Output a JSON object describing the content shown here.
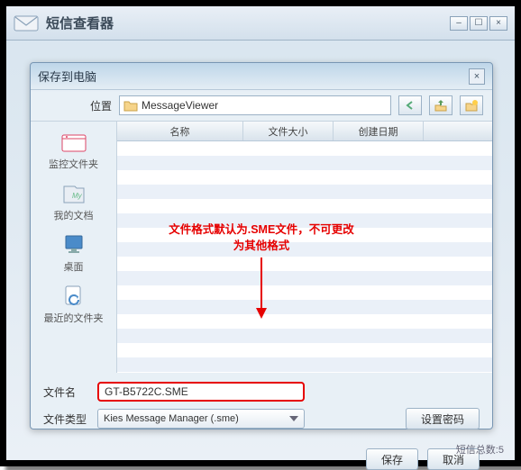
{
  "app": {
    "title": "短信查看器"
  },
  "dialog": {
    "title": "保存到电脑",
    "location_label": "位置",
    "path_text": "MessageViewer",
    "columns": {
      "name": "名称",
      "size": "文件大小",
      "date": "创建日期"
    },
    "sidebar": {
      "items": [
        {
          "label": "监控文件夹"
        },
        {
          "label": "我的文档"
        },
        {
          "label": "桌面"
        },
        {
          "label": "最近的文件夹"
        }
      ]
    },
    "annotation_line1": "文件格式默认为.SME文件，不可更改",
    "annotation_line2": "为其他格式",
    "filename_label": "文件名",
    "filename_value": "GT-B5722C.SME",
    "filetype_label": "文件类型",
    "filetype_value": "Kies Message Manager (.sme)",
    "set_password": "设置密码",
    "save": "保存",
    "cancel": "取消"
  },
  "status": "短信总数:5"
}
